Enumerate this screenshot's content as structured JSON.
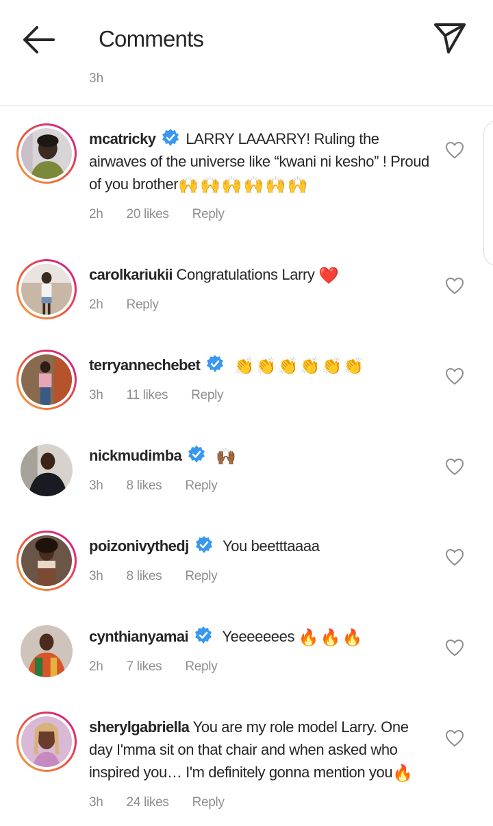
{
  "header": {
    "title": "Comments",
    "back_icon": "arrow-left-icon",
    "send_icon": "paper-plane-icon"
  },
  "previous_comment": {
    "time": "3h"
  },
  "colors": {
    "text": "#262626",
    "secondary": "#8e8e8e",
    "verified": "#3897f0",
    "divider": "#dbdbdb"
  },
  "comments": [
    {
      "username": "mcatricky",
      "verified": true,
      "text": "LARRY LAAARRY! Ruling the airwaves of the universe like “kwani ni kesho” ! Proud of you brother",
      "emoji": "🙌🙌🙌🙌🙌🙌",
      "time": "2h",
      "likes": "20 likes",
      "reply": "Reply"
    },
    {
      "username": "carolkariukii",
      "verified": false,
      "text": "Congratulations Larry",
      "emoji": "❤️",
      "time": "2h",
      "likes": "",
      "reply": "Reply"
    },
    {
      "username": "terryannechebet",
      "verified": true,
      "text": "",
      "emoji": "👏👏👏👏👏👏",
      "time": "3h",
      "likes": "11 likes",
      "reply": "Reply"
    },
    {
      "username": "nickmudimba",
      "verified": true,
      "text": "",
      "emoji": "🙌🏾",
      "time": "3h",
      "likes": "8 likes",
      "reply": "Reply"
    },
    {
      "username": "poizonivythedj",
      "verified": true,
      "text": "You beetttaaaa",
      "emoji": "",
      "time": "3h",
      "likes": "8 likes",
      "reply": "Reply"
    },
    {
      "username": "cynthianyamai",
      "verified": true,
      "text": "Yeeeeeees",
      "emoji": "🔥🔥🔥",
      "time": "2h",
      "likes": "7 likes",
      "reply": "Reply"
    },
    {
      "username": "sherylgabriella",
      "verified": false,
      "text": "You are my role model Larry. One day I'mma sit on that chair and when asked who inspired you… I'm definitely gonna mention you",
      "emoji": "🔥",
      "time": "3h",
      "likes": "24 likes",
      "reply": "Reply"
    }
  ]
}
